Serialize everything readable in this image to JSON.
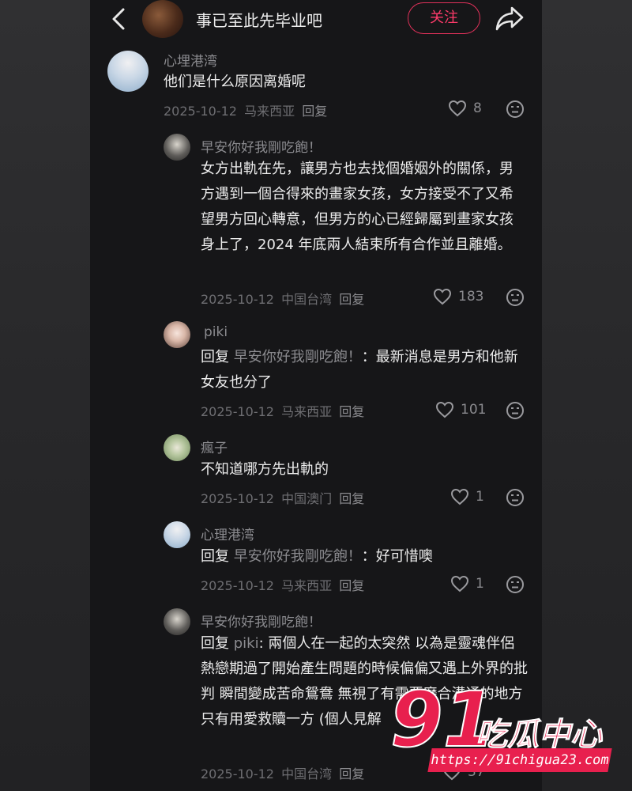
{
  "header": {
    "title": "事已至此先毕业吧",
    "follow_label": "关注"
  },
  "comments": [
    {
      "user": "心埋港湾",
      "text": "他们是什么原因离婚呢",
      "date": "2025-10-12",
      "region": "马来西亚",
      "reply_label": "回复",
      "likes": "8"
    },
    {
      "user": "早安你好我剛吃飽！",
      "text": "女方出軌在先，讓男方也去找個婚姻外的關係，男方遇到一個合得來的畫家女孩，女方接受不了又希望男方回心轉意，但男方的心已經歸屬到畫家女孩身上了，2024 年底兩人結束所有合作並且離婚。",
      "date": "2025-10-12",
      "region": "中国台湾",
      "reply_label": "回复",
      "likes": "183"
    },
    {
      "user": "piki",
      "reply_prefix": "回复",
      "reply_to": "早安你好我剛吃飽！",
      "text": "：最新消息是男方和他新女友也分了",
      "date": "2025-10-12",
      "region": "马来西亚",
      "reply_label": "回复",
      "likes": "101"
    },
    {
      "user": "瘋子",
      "text": "不知道哪方先出軌的",
      "date": "2025-10-12",
      "region": "中国澳门",
      "reply_label": "回复",
      "likes": "1"
    },
    {
      "user": "心理港湾",
      "reply_prefix": "回复",
      "reply_to": "早安你好我剛吃飽！",
      "text": "：好可惜噢",
      "date": "2025-10-12",
      "region": "马来西亚",
      "reply_label": "回复",
      "likes": "1"
    },
    {
      "user": "早安你好我剛吃飽！",
      "reply_prefix": "回复",
      "reply_to": "piki",
      "text": ": 兩個人在一起的太突然 以為是靈魂伴侶 熱戀期過了開始產生問題的時候偏偏又遇上外界的批判 瞬間變成苦命鴛鴦 無視了有需要磨合溝通的地方 只有用愛救贖一方 (個人見解",
      "date": "2025-10-12",
      "region": "中国台湾",
      "reply_label": "回复",
      "likes": "37"
    }
  ],
  "watermark": {
    "number": "91",
    "brand": "吃瓜中心",
    "url": "https://91chigua23.com"
  },
  "colors": {
    "accent": "#e0315a",
    "text": "#ececec",
    "muted": "#8b8b8f",
    "background": "#161618"
  }
}
